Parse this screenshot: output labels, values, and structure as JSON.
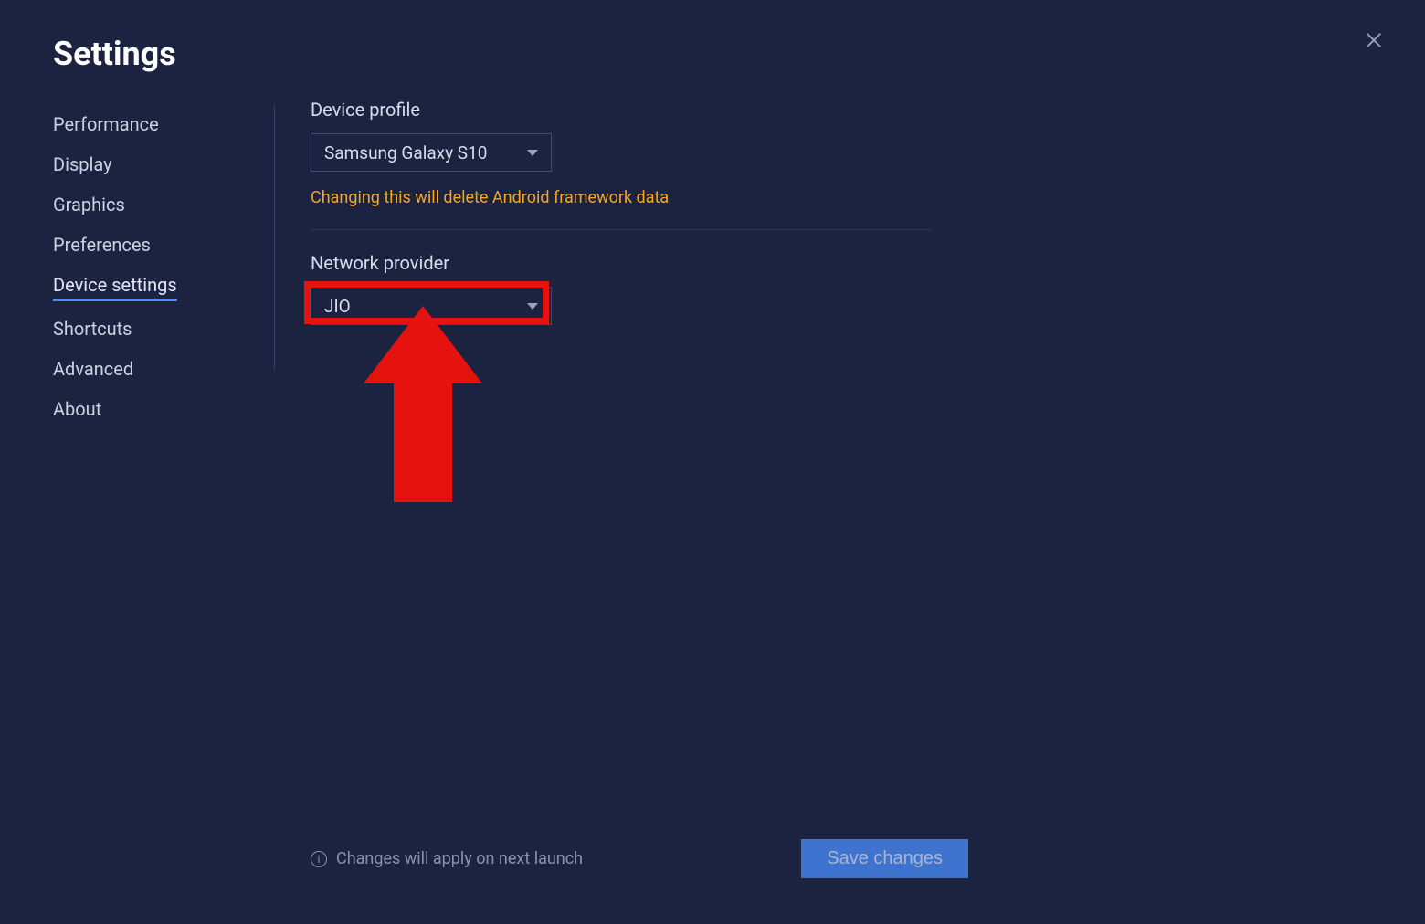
{
  "title": "Settings",
  "sidebar": {
    "items": [
      {
        "label": "Performance",
        "active": false
      },
      {
        "label": "Display",
        "active": false
      },
      {
        "label": "Graphics",
        "active": false
      },
      {
        "label": "Preferences",
        "active": false
      },
      {
        "label": "Device settings",
        "active": true
      },
      {
        "label": "Shortcuts",
        "active": false
      },
      {
        "label": "Advanced",
        "active": false
      },
      {
        "label": "About",
        "active": false
      }
    ]
  },
  "device_profile": {
    "label": "Device profile",
    "selected": "Samsung Galaxy S10",
    "warning": "Changing this will delete Android framework data"
  },
  "network_provider": {
    "label": "Network provider",
    "selected": "JIO"
  },
  "footer": {
    "note": "Changes will apply on next launch",
    "save_label": "Save changes"
  },
  "annotations": {
    "highlight_target": "network-provider-dropdown",
    "arrow_color": "#e5120e"
  }
}
